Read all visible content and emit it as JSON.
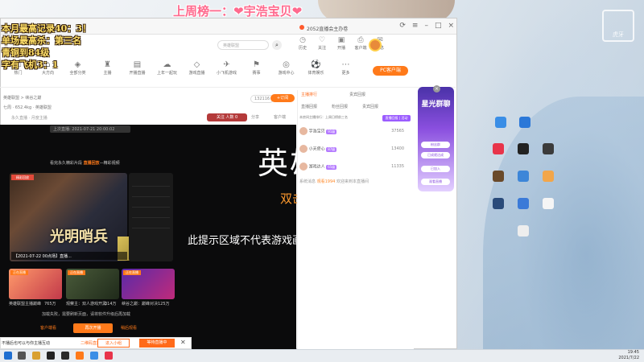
{
  "overlay": {
    "rank_title": "上周榜一：❤宇浩宝贝❤",
    "lines": [
      "本月最高记录40：3！",
      "单场最高杀：第三名",
      "青铜到84级",
      "字有飞机3：1"
    ]
  },
  "watermark": {
    "line1": "虎牙",
    "line2": "HUYA"
  },
  "browser": {
    "tab_title": "2052直播会主办卷",
    "search_placeholder": "英雄联盟",
    "header_icons": [
      {
        "name": "history-icon",
        "label": "历史"
      },
      {
        "name": "follow-icon",
        "label": "关注"
      },
      {
        "name": "broadcast-icon",
        "label": "开播"
      },
      {
        "name": "client-icon",
        "label": "客户端"
      },
      {
        "name": "message-icon",
        "label": "消息"
      }
    ],
    "categories": [
      "热门",
      "大方向",
      "全部分类",
      "主播",
      "开播直播",
      "上年一起玩",
      "游戏直播",
      "小飞机游戏",
      "赛事",
      "游戏中心",
      "体育娱乐",
      "更多"
    ],
    "pc_button": "PC客户端"
  },
  "room": {
    "breadcrumb": "英雄联盟 > 峡谷之巅",
    "stats": "七周 · 652.4kg · 英雄联盟",
    "tags": "永久直播 · 月度主播",
    "room_no": "132116",
    "follow": "+订阅",
    "report": "关注 人数 0",
    "share": "分享",
    "client": "客户端"
  },
  "player": {
    "offline_tag": "上次直播: 2021-07-21 20:00:02",
    "replay_header_prefix": "看完永久精彩片段",
    "replay_header_link": "直播回放",
    "replay_header_suffix": "—精彩视频",
    "video_badge": "精彩回放",
    "video_title_cn": "光明哨兵",
    "video_date": "【2021-07-22 00点场】直播...",
    "big_game_title": "英雄联盟",
    "start_game": "双击启动游戏",
    "hint": "此提示区域不代表游戏画面的实际位置和大小",
    "recs": [
      {
        "caption": "英雄联盟主播巅峰",
        "count": "765万",
        "badge": "正在直播"
      },
      {
        "caption": "观察主：双人游戏开黑",
        "count": "314万",
        "badge": "正在直播"
      },
      {
        "caption": "峡谷之巅：巅峰对决",
        "count": "125万",
        "badge": "正在直播"
      }
    ],
    "load_fail": "加载失败，需要刷新页面，请将软件升级后再加载",
    "btn_client": "客户端看",
    "btn_open": "再次开播",
    "btn_tick": "稍后观看"
  },
  "right_panel": {
    "tabs": [
      "主播排行",
      "贵宾回报"
    ],
    "sub_tabs": [
      "直播回报",
      "粉丝回报",
      "贵宾回报"
    ],
    "notice": "本房间主播排行：上周日榜前三名",
    "notice_btn": "直播回报 | 活动",
    "ranks": [
      {
        "name": "宇浩宝贝",
        "badge": "91级",
        "score": "37565"
      },
      {
        "name": "小天使心",
        "badge": "87级",
        "score": "13400"
      },
      {
        "name": "游戏达人",
        "badge": "65级",
        "score": "11335"
      }
    ],
    "welcome_prefix": "系统消息",
    "welcome_user": "观看1994",
    "welcome_suffix": "欢迎来到本直播间"
  },
  "promo": {
    "title": "星光群聊",
    "chips": [
      "粉丝群",
      "已成就达成",
      "已加入",
      "观看直播"
    ]
  },
  "popup": {
    "text": "不播后也可以与你主播互动",
    "link": "二维码直播",
    "btn1": "进入小组",
    "btn2": "等待直播中"
  },
  "taskbar": {
    "time": "19:45",
    "date": "2021/7/22"
  }
}
